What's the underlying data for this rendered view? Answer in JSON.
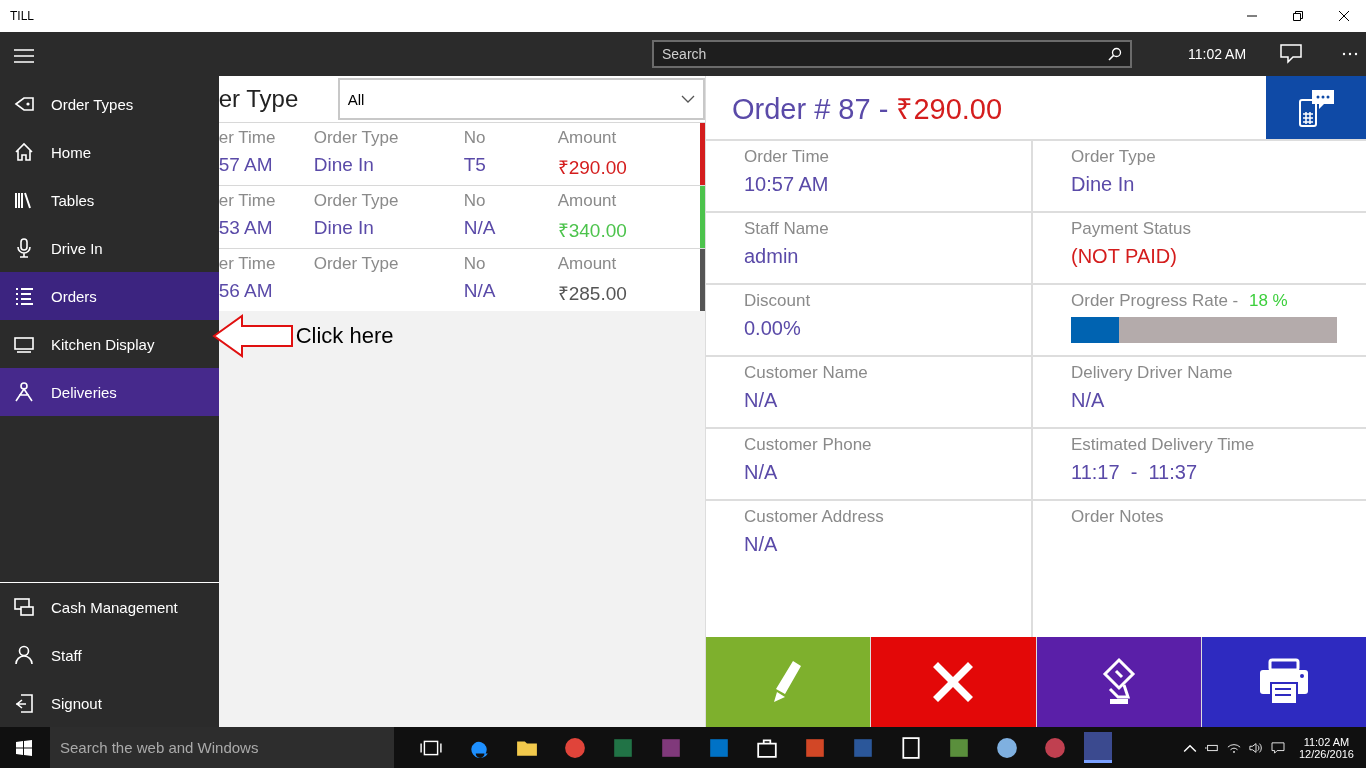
{
  "window": {
    "title": "TILL"
  },
  "app_bar": {
    "search": {
      "placeholder": "Search"
    },
    "time": "11:02 AM"
  },
  "nav": {
    "items": [
      {
        "label": "Order Types",
        "selected": false,
        "hovered": false
      },
      {
        "label": "Home",
        "selected": false,
        "hovered": false
      },
      {
        "label": "Tables",
        "selected": false,
        "hovered": false
      },
      {
        "label": "Drive In",
        "selected": false,
        "hovered": false
      },
      {
        "label": "Orders",
        "selected": false,
        "hovered": true
      },
      {
        "label": "Kitchen Display",
        "selected": false,
        "hovered": false
      },
      {
        "label": "Deliveries",
        "selected": true,
        "hovered": false
      }
    ],
    "bottom_items": [
      {
        "label": "Cash Management",
        "selected": false,
        "hovered": false
      },
      {
        "label": "Staff",
        "selected": false,
        "hovered": false
      },
      {
        "label": "Signout",
        "selected": false,
        "hovered": false
      }
    ]
  },
  "orders": {
    "heading": "er Type",
    "filter": {
      "value": "All"
    },
    "rows": [
      {
        "color": "#d41d1d",
        "cells": [
          {
            "label": "er Time",
            "value": "57 AM"
          },
          {
            "label": "Order Type",
            "value": "Dine In"
          },
          {
            "label": "No",
            "value": "T5"
          },
          {
            "label": "Amount",
            "value": "₹290.00"
          }
        ]
      },
      {
        "color": "#4cc34c",
        "cells": [
          {
            "label": "er Time",
            "value": "53 AM"
          },
          {
            "label": "Order Type",
            "value": "Dine In"
          },
          {
            "label": "No",
            "value": "N/A"
          },
          {
            "label": "Amount",
            "value": "₹340.00"
          }
        ]
      },
      {
        "color": "#555555",
        "cells": [
          {
            "label": "er Time",
            "value": "56 AM"
          },
          {
            "label": "Order Type"
          },
          {
            "label": "No",
            "value": "N/A"
          },
          {
            "label": "Amount",
            "value": "₹285.00"
          }
        ]
      }
    ]
  },
  "annotation": {
    "text": "Click here"
  },
  "detail": {
    "title": "Order # 87 - ",
    "total": "₹290.00",
    "fields": [
      {
        "kind": "text",
        "label": "Order Time",
        "value": "10:57 AM"
      },
      {
        "kind": "text",
        "label": "Order Type",
        "value": "Dine In"
      },
      {
        "kind": "text",
        "label": "Staff Name",
        "value": "admin"
      },
      {
        "kind": "alert",
        "label": "Payment Status",
        "value": "(NOT PAID)"
      },
      {
        "kind": "text",
        "label": "Discount",
        "value": "0.00%"
      },
      {
        "kind": "progress",
        "label": "Order Progress Rate - ",
        "reading": "18 %",
        "level": 0.18
      },
      {
        "kind": "text",
        "label": "Customer Name",
        "value": "N/A"
      },
      {
        "kind": "text",
        "label": "Delivery Driver Name",
        "value": "N/A"
      },
      {
        "kind": "text",
        "label": "Customer Phone",
        "value": "N/A"
      },
      {
        "kind": "text",
        "label": "Estimated Delivery Time",
        "value": "11:17  -  11:37"
      },
      {
        "kind": "text",
        "label": "Customer Address",
        "value": "N/A"
      },
      {
        "kind": "text",
        "label": "Order Notes"
      }
    ],
    "actions": [
      {
        "kind": "edit",
        "color": "#7eb02d"
      },
      {
        "kind": "cancel",
        "color": "#e30808"
      },
      {
        "kind": "pay",
        "color": "#5a1fa8"
      },
      {
        "kind": "print",
        "color": "#2e2ac0"
      }
    ]
  },
  "taskbar": {
    "search": {
      "placeholder": "Search the web and Windows"
    },
    "time": "11:02 AM",
    "date": "12/26/2016"
  }
}
